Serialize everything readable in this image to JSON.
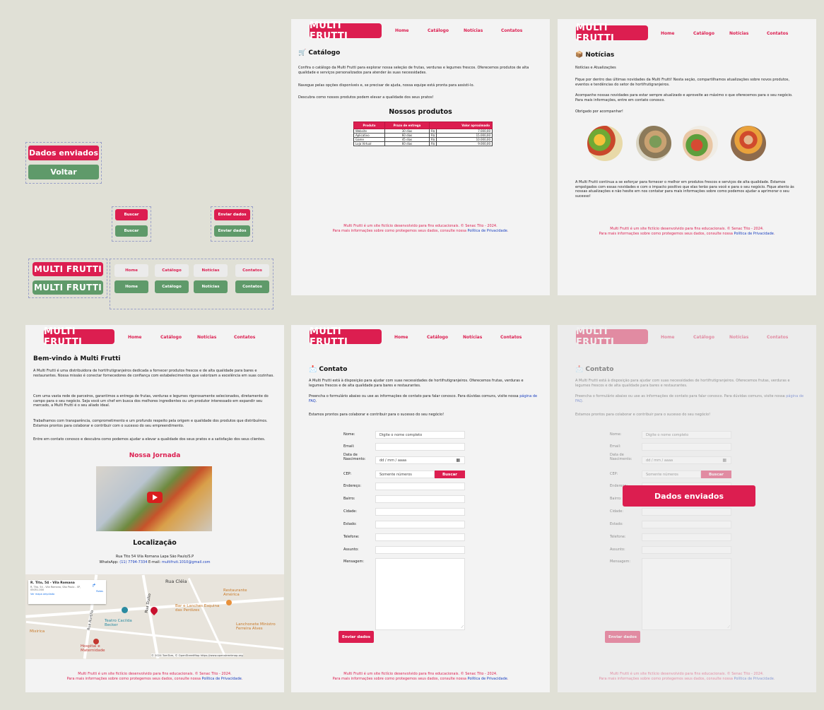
{
  "brand": "MULTI FRUTTI",
  "nav": [
    "Home",
    "Catálogo",
    "Notícias",
    "Contatos"
  ],
  "colors": {
    "accent": "#dc1e50",
    "green": "#5f9a6a",
    "link": "#1a3fbf",
    "canvas": "#e0e0d6"
  },
  "footer": {
    "line1": "Multi Frutti é um site fictício desenvolvido para fins educacionais. © Senac Tito - 2024.",
    "line2_prefix": "Para mais informações sobre como protegemos seus dados, consulte nossa ",
    "line2_link": "Política de Privacidade",
    "line2_suffix": "."
  },
  "components": {
    "sent_badge": "Dados enviados",
    "back_button": "Voltar",
    "search_red": "Buscar",
    "search_green": "Buscar",
    "send_red": "Enviar dados",
    "send_green": "Enviar dados",
    "logo_red": "MULTI FRUTTI",
    "logo_green": "MULTI FRUTTI",
    "nav_gray": [
      "Home",
      "Catálogo",
      "Notícias",
      "Contatos"
    ],
    "nav_green": [
      "Home",
      "Catálogo",
      "Notícias",
      "Contatos"
    ]
  },
  "catalog": {
    "title": "🛒 Catálogo",
    "p1": "Confira o catálogo da Multi Frutti para explorar nossa seleção de frutas, verduras e legumes frescos. Oferecemos produtos de alta qualidade e serviços personalizados para atender às suas necessidades.",
    "p2": "Navegue pelas opções disponíveis e, se precisar de ajuda, nossa equipe está pronta para assisti-lo.",
    "p3": "Descubra como nossos produtos podem elevar a qualidade dos seus pratos!",
    "table_title": "Nossos produtos",
    "headers": [
      "Produto",
      "Prazo de entrega",
      "Valor aproximado"
    ],
    "rows": [
      [
        "Website",
        "30 dias",
        "R$",
        "7.000,00"
      ],
      [
        "Aplicativo",
        "60 dias",
        "R$",
        "15.000,00"
      ],
      [
        "Game",
        "45 dias",
        "R$",
        "10.000,00"
      ],
      [
        "Loja Virtual",
        "60 dias",
        "R$",
        "9.000,00"
      ]
    ]
  },
  "news": {
    "title": "📦 Notícias",
    "subtitle": "Notícias e Atualizações",
    "p1": "Fique por dentro das últimas novidades da Multi Frutti! Nesta seção, compartilhamos atualizações sobre novos produtos, eventos e tendências do setor de hortifrutigranjeiros.",
    "p2": "Acompanhe nossas novidades para estar sempre atualizado e aproveite ao máximo o que oferecemos para o seu negócio. Para mais informações, entre em contato conosco.",
    "p3": "Obrigado por acompanhar!",
    "p4": "A Multi Frutti continua a se esforçar para fornecer o melhor em produtos frescos e serviços de alta qualidade. Estamos empolgados com essas novidades e com o impacto positivo que elas terão para você e para o seu negócio. Fique atento às nossas atualizações e não hesite em nos contatar para mais informações sobre como podemos ajudar a aprimorar o seu sucesso!"
  },
  "home": {
    "title": "Bem-vindo à Multi Frutti",
    "p1": "A Multi Frutti é uma distribuidora de hortifrutigranjeiros dedicada a fornecer produtos frescos e de alta qualidade para bares e restaurantes. Nossa missão é conectar fornecedores de confiança com estabelecimentos que valorizam a excelência em suas cozinhas.",
    "p2": "Com uma vasta rede de parceiros, garantimos a entrega de frutas, verduras e legumes rigorosamente selecionados, diretamente do campo para o seu negócio. Seja você um chef em busca dos melhores ingredientes ou um produtor interessado em expandir seu mercado, a Multi Frutti é o seu aliado ideal.",
    "p3": "Trabalhamos com transparência, comprometimento e um profundo respeito pela origem e qualidade dos produtos que distribuímos. Estamos prontos para colaborar e contribuir com o sucesso do seu empreendimento.",
    "p4": "Entre em contato conosco e descubra como podemos ajudar a elevar a qualidade dos seus pratos e a satisfação dos seus clientes.",
    "journey": "Nossa Jornada",
    "location_title": "Localização",
    "address": "Rua Tito 54 Vila Romana Lapa São Paulo/S.P",
    "whatsapp_label": "WhatsApp: ",
    "whatsapp": "(11) 7794-7334",
    "email_label": " E-mail: ",
    "email": "multifruti.1010@gmail.com",
    "map": {
      "card_title": "R. Tito, 54 - Vila Romana",
      "card_sub": "R. Tito, 54 - Vila Romana, São Paulo - SP, 05051-000",
      "card_route": "Rotas",
      "card_link": "Ver mapa ampliado",
      "street1": "Rua Cléia",
      "street2": "Rua Duílio",
      "street3": "Rua Aurélia",
      "poi1": "Restaurante América",
      "poi2": "Bar e Lanches Esquina das Perdizes",
      "poi3": "Teatro Cacilda Becker",
      "poi4": "Lanchonete Ministro Ferreira Alves",
      "poi5": "Hospital e Maternidade",
      "poi6": "Mixirica",
      "attribution": "© 2024 TomTom, © OpenStreetMap https://www.openstreetmap.org"
    }
  },
  "contact": {
    "title": "📩 Contato",
    "p1": "A Multi Frutti está à disposição para ajudar com suas necessidades de hortifrutigranjeiros. Oferecemos frutas, verduras e legumes frescos e de alta qualidade para bares e restaurantes.",
    "p2_prefix": "Preencha o formulário abaixo ou use as informações de contato para falar conosco. Para dúvidas comuns, visite nossa ",
    "p2_link": "página de FAQ",
    "p2_suffix": ".",
    "p3": "Estamos prontos para colaborar e contribuir para o sucesso do seu negócio!",
    "labels": {
      "name": "Nome:",
      "email": "Email:",
      "birth": "Data de Nascimento:",
      "cep": "CEP:",
      "address": "Endereço:",
      "district": "Bairro:",
      "city": "Cidade:",
      "state": "Estado:",
      "phone": "Telefone:",
      "subject": "Assunto:",
      "message": "Mensagem:"
    },
    "placeholders": {
      "name": "Digite o nome completo",
      "birth": "dd / mm / aaaa",
      "cep": "Somente números"
    },
    "search": "Buscar",
    "submit": "Enviar dados",
    "sent": "Dados enviados"
  }
}
